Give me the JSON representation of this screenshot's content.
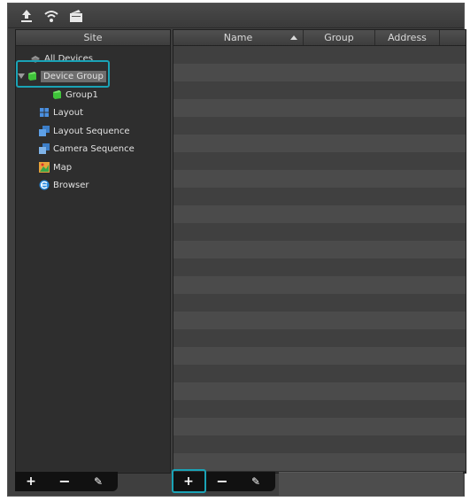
{
  "toolbar": {
    "icons": [
      "upload-icon",
      "wifi-icon",
      "folder-icon"
    ]
  },
  "site_panel": {
    "header": "Site",
    "items": [
      {
        "label": "All Devices",
        "icon": "all-devices-icon"
      },
      {
        "label": "Device Group",
        "icon": "device-group-icon",
        "selected": true
      },
      {
        "label": "Group1",
        "icon": "group-icon"
      },
      {
        "label": "Layout",
        "icon": "layout-icon"
      },
      {
        "label": "Layout Sequence",
        "icon": "layout-sequence-icon"
      },
      {
        "label": "Camera Sequence",
        "icon": "camera-sequence-icon"
      },
      {
        "label": "Map",
        "icon": "map-icon"
      },
      {
        "label": "Browser",
        "icon": "browser-icon"
      }
    ]
  },
  "table": {
    "columns": [
      "Name",
      "Group",
      "Address"
    ]
  },
  "left_buttons": {
    "add": "+",
    "remove": "−",
    "edit": "✎"
  },
  "right_buttons": {
    "add": "+",
    "remove": "−",
    "edit": "✎"
  }
}
